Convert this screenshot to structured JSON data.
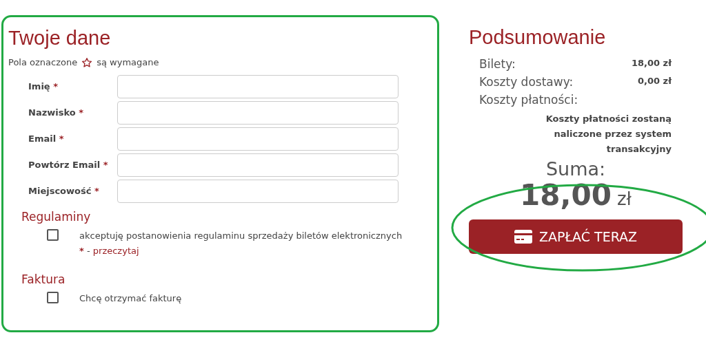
{
  "form": {
    "title": "Twoje dane",
    "required_note": {
      "before": "Pola oznaczone",
      "after": "są wymagane"
    },
    "fields": [
      {
        "label": "Imię",
        "mark": "*"
      },
      {
        "label": "Nazwisko",
        "mark": "*"
      },
      {
        "label": "Email",
        "mark": "*"
      },
      {
        "label": "Powtórz Email",
        "mark": "*"
      },
      {
        "label": "Miejscowość",
        "mark": "*"
      }
    ],
    "sections": [
      {
        "heading": "Regulaminy",
        "checked": false,
        "text": "akceptuję postanowienia regulaminu sprzedaży biletów elektronicznych",
        "mark": "*",
        "separator": "-",
        "link": "przeczytaj"
      },
      {
        "heading": "Faktura",
        "checked": false,
        "text": "Chcę otrzymać fakturę"
      }
    ]
  },
  "summary": {
    "title": "Podsumowanie",
    "rows": [
      {
        "label": "Bilety:",
        "value": "18,00 zł"
      },
      {
        "label": "Koszty dostawy:",
        "value": "0,00 zł"
      },
      {
        "label": "Koszty płatności:"
      }
    ],
    "note": "Koszty płatności zostaną naliczone przez system transakcyjny",
    "total_label": "Suma:",
    "total_amount": "18,00",
    "total_currency": "zł",
    "pay_button": "ZAPŁAĆ TERAZ"
  }
}
